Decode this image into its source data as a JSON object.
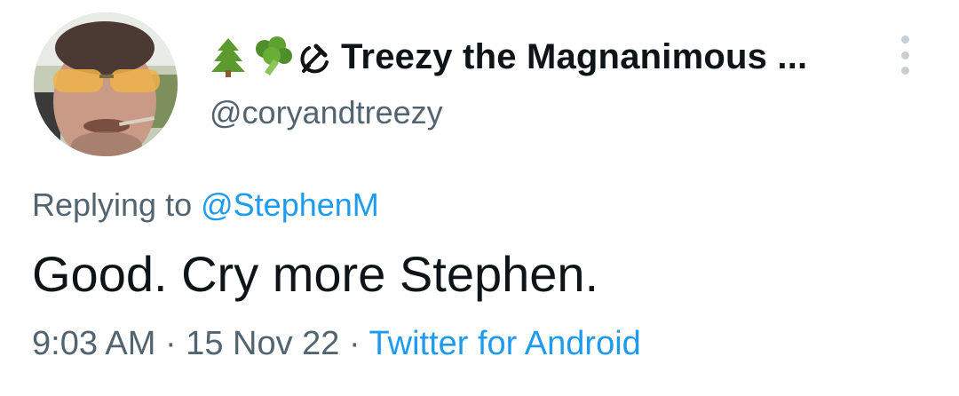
{
  "author": {
    "display_name": "Treezy the Magnanimous ...",
    "handle": "@coryandtreezy",
    "avatar": "profile-photo",
    "name_emojis": [
      "evergreen-tree-icon",
      "broccoli-icon",
      "hammer-and-sickle-icon"
    ]
  },
  "reply": {
    "prefix": "Replying to",
    "mention": "@StephenM"
  },
  "tweet": {
    "text": "Good. Cry more Stephen."
  },
  "meta": {
    "time": "9:03 AM",
    "separator": "·",
    "date": "15 Nov 22",
    "source": "Twitter for Android"
  },
  "menu": {
    "icon": "more-vertical-icon"
  },
  "colors": {
    "text_primary": "#0f1419",
    "text_secondary": "#536471",
    "link": "#1d9bf0"
  }
}
